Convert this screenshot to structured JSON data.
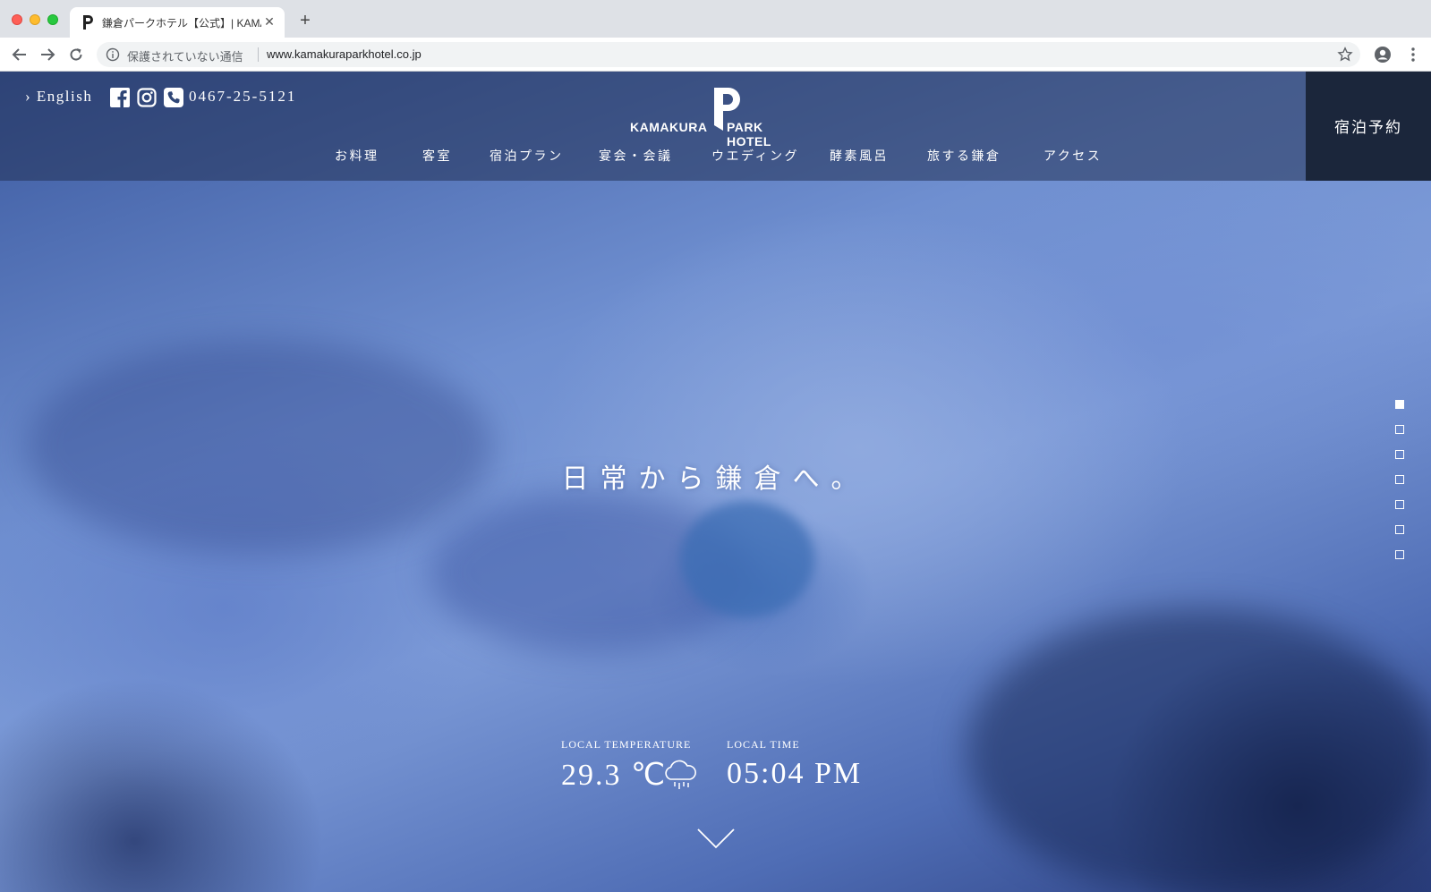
{
  "browser": {
    "tab_title": "鎌倉パークホテル【公式】| KAMAKURA PARK HOTEL",
    "security_label": "保護されていない通信",
    "url": "www.kamakuraparkhotel.co.jp"
  },
  "header": {
    "lang_link": "› English",
    "phone": "0467-25-5121",
    "logo": {
      "left": "KAMAKURA",
      "right": "PARK HOTEL"
    },
    "nav": [
      "お料理",
      "客室",
      "宿泊プラン",
      "宴会・会議",
      "ウエディング",
      "酵素風呂",
      "旅する鎌倉",
      "アクセス"
    ],
    "reserve_label": "宿泊予約"
  },
  "hero": {
    "catch_copy": "日常から鎌倉へ。",
    "slides_total": 7,
    "slides_active_index": 0
  },
  "weather": {
    "temp_label": "LOCAL TEMPERATURE",
    "temp_value": "29.3 ℃",
    "weather_icon": "rain-cloud-icon",
    "time_label": "LOCAL TIME",
    "time_value": "05:04 PM"
  },
  "colors": {
    "header_overlay": "#233255",
    "reserve_bg": "#141c2d",
    "hero_blue": "#6f8fd0"
  }
}
